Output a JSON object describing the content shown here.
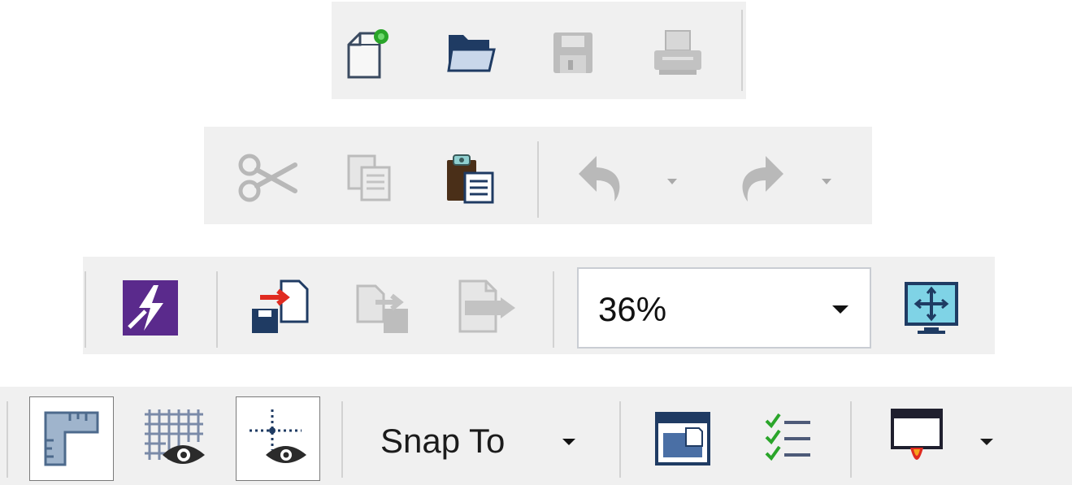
{
  "toolbar_file": {
    "buttons": [
      {
        "name": "new-document",
        "icon": "new-document-icon",
        "enabled": true
      },
      {
        "name": "open",
        "icon": "folder-open-icon",
        "enabled": true
      },
      {
        "name": "save",
        "icon": "floppy-disk-icon",
        "enabled": false
      },
      {
        "name": "print",
        "icon": "printer-icon",
        "enabled": false
      }
    ]
  },
  "toolbar_edit": {
    "buttons": [
      {
        "name": "cut",
        "icon": "scissors-icon",
        "enabled": false
      },
      {
        "name": "copy",
        "icon": "copy-icon",
        "enabled": false
      },
      {
        "name": "paste",
        "icon": "clipboard-icon",
        "enabled": true
      },
      {
        "name": "undo",
        "icon": "undo-icon",
        "enabled": false,
        "has_dropdown": true
      },
      {
        "name": "redo",
        "icon": "redo-icon",
        "enabled": false,
        "has_dropdown": true
      }
    ]
  },
  "toolbar_view": {
    "buttons": [
      {
        "name": "app-launcher",
        "icon": "app-launcher-icon",
        "enabled": true
      },
      {
        "name": "import",
        "icon": "import-icon",
        "enabled": true
      },
      {
        "name": "export",
        "icon": "export-icon",
        "enabled": false
      },
      {
        "name": "publish-pdf",
        "icon": "pdf-export-icon",
        "enabled": false
      }
    ],
    "zoom": {
      "value": "36%"
    },
    "full_screen": {
      "icon": "full-screen-preview-icon"
    }
  },
  "toolbar_layout": {
    "buttons": [
      {
        "name": "rulers",
        "icon": "ruler-icon",
        "checked": true
      },
      {
        "name": "grid",
        "icon": "grid-eye-icon",
        "checked": false
      },
      {
        "name": "guidelines",
        "icon": "guidelines-eye-icon",
        "checked": true
      }
    ],
    "snap_to_label": "Snap To",
    "extra": [
      {
        "name": "page-layout",
        "icon": "page-layout-icon"
      },
      {
        "name": "checklist",
        "icon": "checklist-icon"
      },
      {
        "name": "launch",
        "icon": "launch-icon",
        "has_dropdown": true
      }
    ]
  },
  "colors": {
    "toolbar_bg": "#f0f0f0",
    "icon_navy": "#1f3b63",
    "icon_disabled": "#b9b9b9",
    "icon_purple": "#5a2a8c",
    "accent_red": "#e02b20",
    "accent_green": "#2aa52a"
  }
}
